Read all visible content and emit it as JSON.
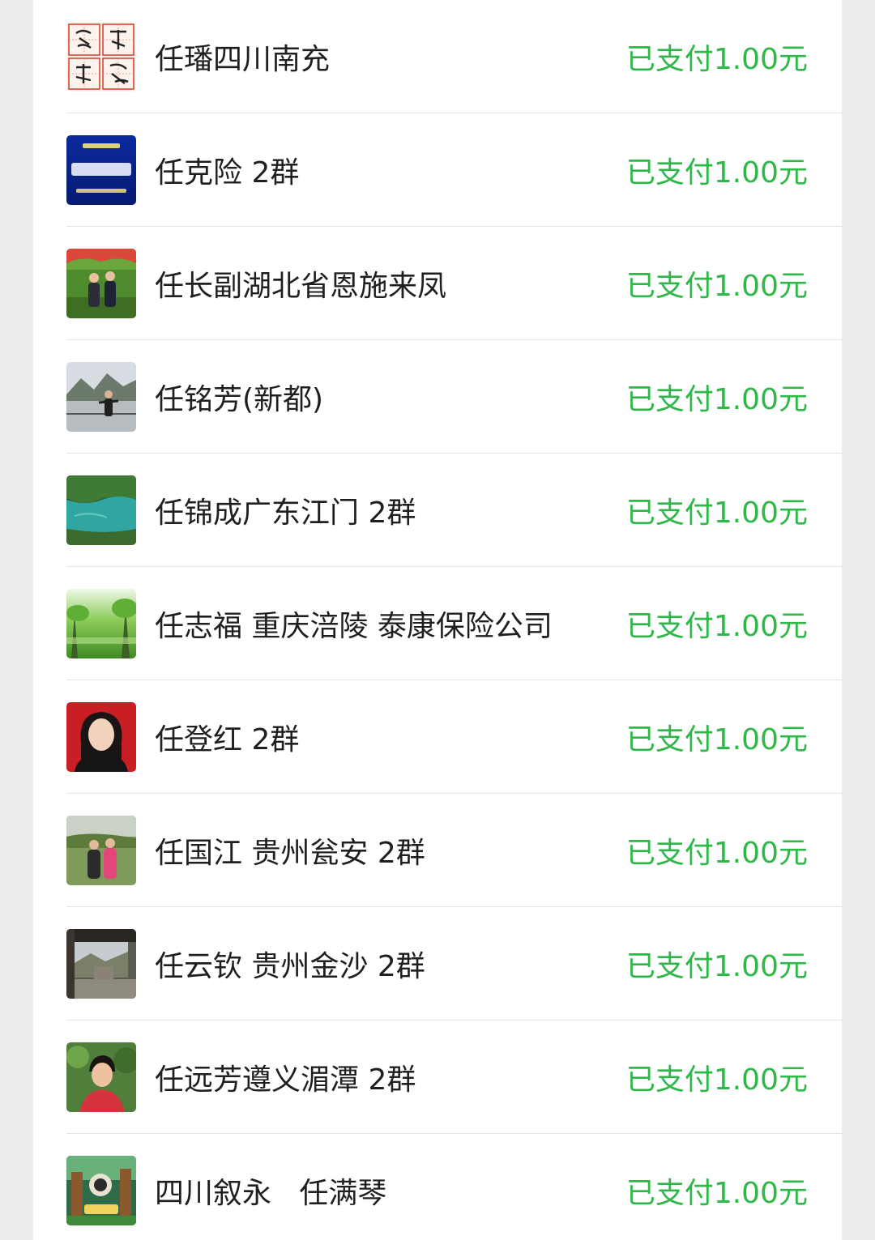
{
  "colors": {
    "page_background": "#ededed",
    "list_background": "#ffffff",
    "name_text": "#1f1f1f",
    "status_text": "#2fb74a",
    "divider": "#e4e4e4"
  },
  "payments": [
    {
      "name": "任璠四川南充",
      "status": "已支付1.00元",
      "avatar": "calligraphy-avatar-icon"
    },
    {
      "name": "任克险 2群",
      "status": "已支付1.00元",
      "avatar": "amitabha-text-avatar-icon"
    },
    {
      "name": "任长副湖北省恩施来凤",
      "status": "已支付1.00元",
      "avatar": "couple-photo-avatar-icon"
    },
    {
      "name": "任铭芳(新都)",
      "status": "已支付1.00元",
      "avatar": "riverside-photo-avatar-icon"
    },
    {
      "name": "任锦成广东江门 2群",
      "status": "已支付1.00元",
      "avatar": "lake-photo-avatar-icon"
    },
    {
      "name": "任志福 重庆涪陵 泰康保险公司",
      "status": "已支付1.00元",
      "avatar": "green-forest-avatar-icon"
    },
    {
      "name": "任登红 2群",
      "status": "已支付1.00元",
      "avatar": "portrait-photo-avatar-icon"
    },
    {
      "name": "任国江 贵州瓮安 2群",
      "status": "已支付1.00元",
      "avatar": "two-people-photo-avatar-icon"
    },
    {
      "name": "任云钦 贵州金沙 2群",
      "status": "已支付1.00元",
      "avatar": "gate-photo-avatar-icon"
    },
    {
      "name": "任远芳遵义湄潭 2群",
      "status": "已支付1.00元",
      "avatar": "selfie-photo-avatar-icon"
    },
    {
      "name": "四川叙永   任满琴",
      "status": "已支付1.00元",
      "avatar": "cartoon-scene-avatar-icon"
    }
  ]
}
